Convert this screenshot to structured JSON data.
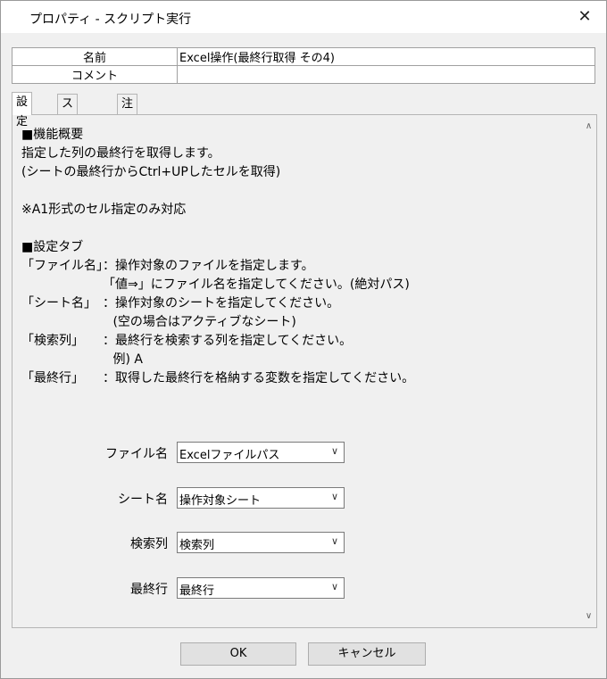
{
  "window": {
    "title": "プロパティ - スクリプト実行",
    "close_glyph": "✕"
  },
  "props": [
    {
      "key": "名前",
      "value": "Excel操作(最終行取得 その4)"
    },
    {
      "key": "コメント",
      "value": ""
    }
  ],
  "tabs": [
    "設定",
    "スクリプト",
    "注釈"
  ],
  "description": "■機能概要\n指定した列の最終行を取得します。\n(シートの最終行からCtrl+UPしたセルを取得)\n\n※A1形式のセル指定のみ対応\n\n■設定タブ\n「ファイル名」：操作対象のファイルを指定します。\n　　　　　　　「値⇒」にファイル名を指定してください。(絶対パス)\n「シート名」　：操作対象のシートを指定してください。\n　　　　　　　 (空の場合はアクティブなシート)\n「検索列」　　：最終行を検索する列を指定してください。\n　　　　　　　 例) A\n「最終行」　　：取得した最終行を格納する変数を指定してください。",
  "fields": [
    {
      "label": "ファイル名",
      "value": "Excelファイルパス"
    },
    {
      "label": "シート名",
      "value": "操作対象シート"
    },
    {
      "label": "検索列",
      "value": "検索列"
    },
    {
      "label": "最終行",
      "value": "最終行"
    }
  ],
  "buttons": {
    "ok": "OK",
    "cancel": "キャンセル"
  },
  "icons": {
    "scroll_up": "chevron-up-icon",
    "scroll_down": "chevron-down-icon",
    "combo": "chevron-down-icon"
  }
}
